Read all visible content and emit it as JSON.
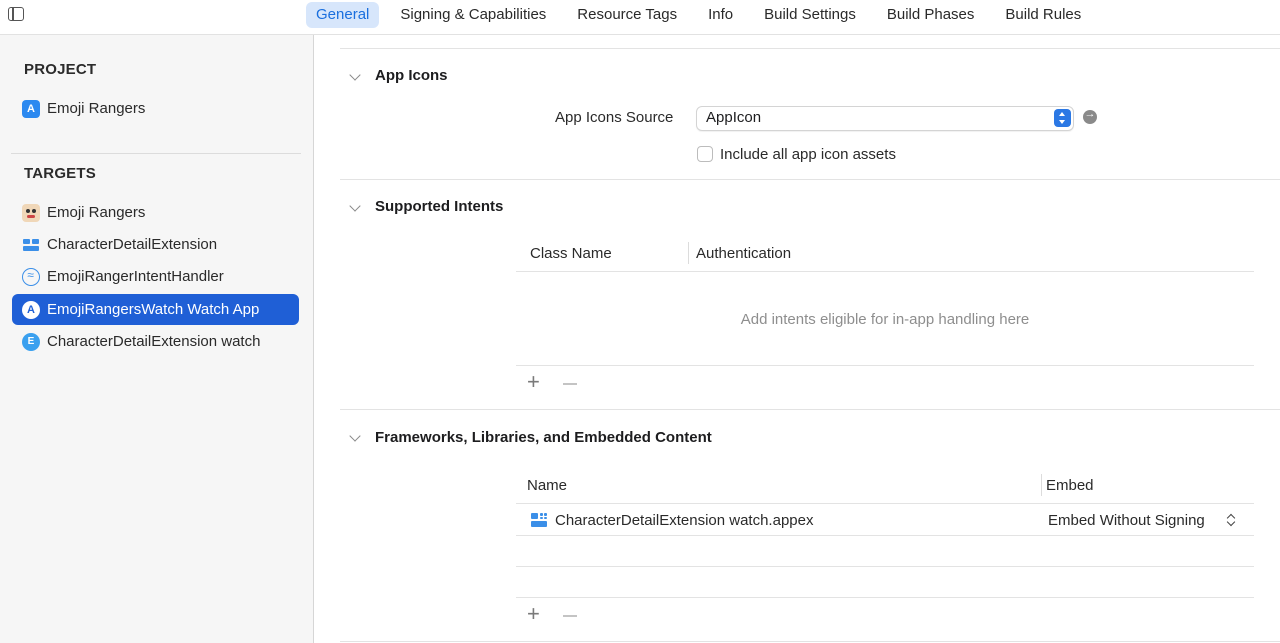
{
  "tabs": [
    {
      "label": "General",
      "active": true
    },
    {
      "label": "Signing & Capabilities",
      "active": false
    },
    {
      "label": "Resource Tags",
      "active": false
    },
    {
      "label": "Info",
      "active": false
    },
    {
      "label": "Build Settings",
      "active": false
    },
    {
      "label": "Build Phases",
      "active": false
    },
    {
      "label": "Build Rules",
      "active": false
    }
  ],
  "sidebar": {
    "project_header": "PROJECT",
    "project_item": {
      "label": "Emoji Rangers",
      "icon": "app-project-icon"
    },
    "targets_header": "TARGETS",
    "targets": [
      {
        "label": "Emoji Rangers",
        "icon": "panda-app-icon",
        "selected": false
      },
      {
        "label": "CharacterDetailExtension",
        "icon": "widget-extension-icon",
        "selected": false
      },
      {
        "label": "EmojiRangerIntentHandler",
        "icon": "intent-handler-icon",
        "selected": false
      },
      {
        "label": "EmojiRangersWatch Watch App",
        "icon": "watch-app-icon",
        "selected": true
      },
      {
        "label": "CharacterDetailExtension watch",
        "icon": "extension-icon",
        "selected": false
      }
    ]
  },
  "app_icons": {
    "title": "App Icons",
    "source_label": "App Icons Source",
    "source_value": "AppIcon",
    "include_all_label": "Include all app icon assets",
    "include_all_checked": false
  },
  "supported_intents": {
    "title": "Supported Intents",
    "columns": [
      "Class Name",
      "Authentication"
    ],
    "empty_message": "Add intents eligible for in-app handling here",
    "add_symbol": "+"
  },
  "frameworks": {
    "title": "Frameworks, Libraries, and Embedded Content",
    "columns": [
      "Name",
      "Embed"
    ],
    "rows": [
      {
        "name": "CharacterDetailExtension watch.appex",
        "embed": "Embed Without Signing",
        "icon": "appex-icon"
      }
    ],
    "add_symbol": "+"
  },
  "colors": {
    "accent": "#1a6fde",
    "selection": "#1f5fd6",
    "tab_active_bg": "#d7e6fb"
  }
}
